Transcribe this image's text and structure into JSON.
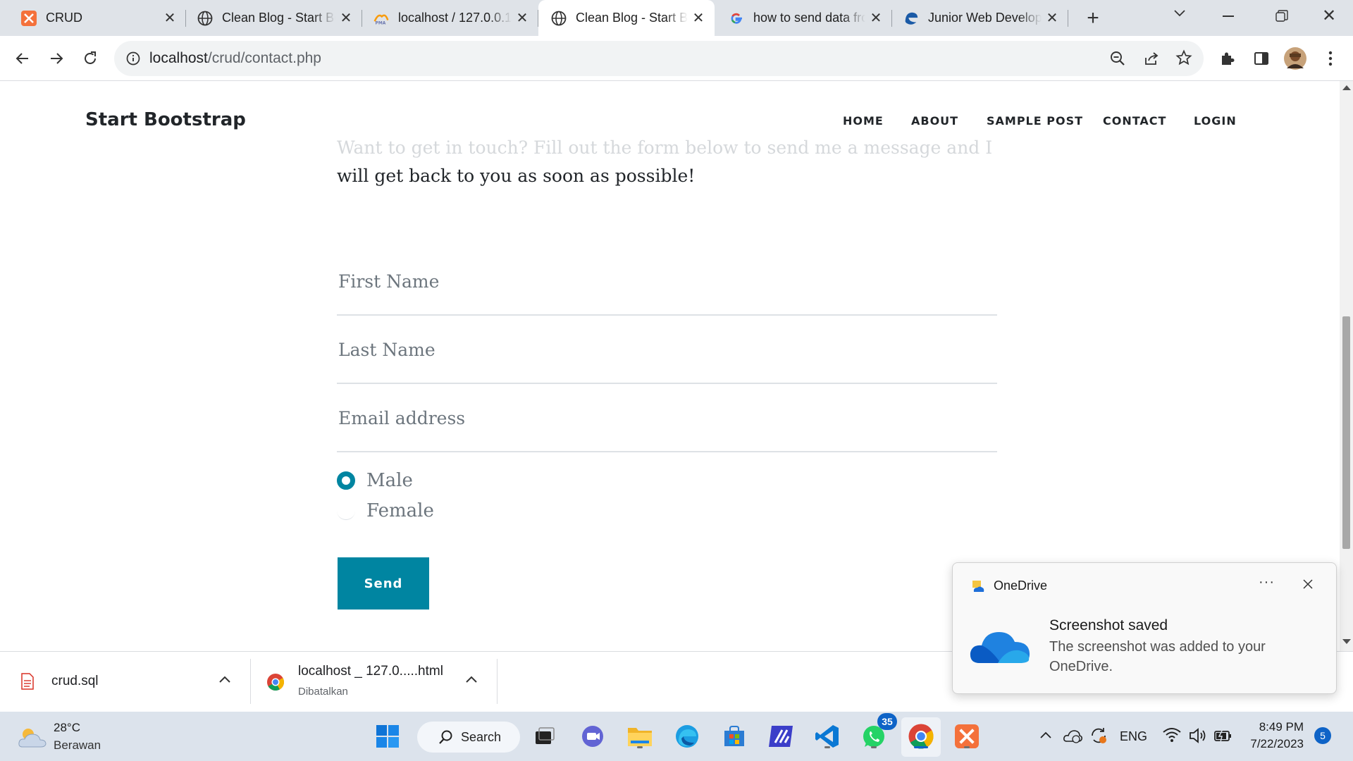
{
  "browser": {
    "tabs": [
      {
        "title": "CRUD",
        "icon": "xampp-icon",
        "active": false
      },
      {
        "title": "Clean Blog - Start Bootstrap",
        "icon": "globe-icon",
        "active": false
      },
      {
        "title": "localhost / 127.0.0.1",
        "icon": "phpmyadmin-icon",
        "active": false
      },
      {
        "title": "Clean Blog - Start Bootstrap",
        "icon": "globe-icon",
        "active": true
      },
      {
        "title": "how to send data from",
        "icon": "google-icon",
        "active": false
      },
      {
        "title": "Junior Web Developer",
        "icon": "edge-style-icon",
        "active": false
      }
    ],
    "url_host": "localhost",
    "url_path": "/crud/contact.php"
  },
  "page": {
    "brand": "Start Bootstrap",
    "nav": [
      "HOME",
      "ABOUT",
      "SAMPLE POST",
      "CONTACT",
      "LOGIN"
    ],
    "intro_line1": "Want to get in touch? Fill out the form below to send me a message and I",
    "intro_line2": "will get back to you as soon as possible!",
    "form": {
      "first_name_placeholder": "First Name",
      "last_name_placeholder": "Last Name",
      "email_placeholder": "Email address",
      "gender_options": [
        "Male",
        "Female"
      ],
      "gender_selected": "Male",
      "send_label": "Send"
    },
    "accent_color": "#0085a1"
  },
  "downloads": [
    {
      "name": "crud.sql",
      "status": ""
    },
    {
      "name": "localhost _ 127.0.....html",
      "status": "Dibatalkan"
    }
  ],
  "toast": {
    "app": "OneDrive",
    "title": "Screenshot saved",
    "body": "The screenshot was added to your OneDrive."
  },
  "taskbar": {
    "weather_temp": "28°C",
    "weather_desc": "Berawan",
    "search_label": "Search",
    "whatsapp_badge": "35",
    "lang": "ENG",
    "time": "8:49 PM",
    "date": "7/22/2023",
    "notification_count": "5"
  }
}
